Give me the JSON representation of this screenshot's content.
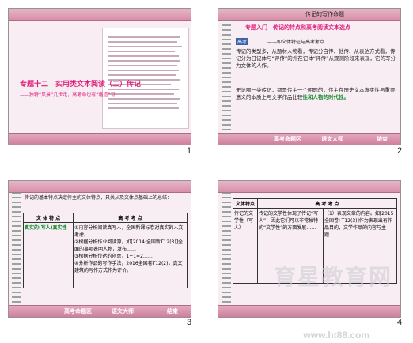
{
  "slides": [
    {
      "number": "1",
      "header": "",
      "title": "专题十二　实用类文本阅读（二）传记",
      "subtitle": "——独特“风景”几步走，高考命也有“路道”习",
      "nav": [
        "",
        "",
        ""
      ]
    },
    {
      "number": "2",
      "header": "传记的写作命题",
      "title": "专题入门　传记的特点和高考阅读文本选点",
      "badge": "高考",
      "sub": "——即文体特征与高考考点",
      "paragraphs": [
        "传记的类型多，从题材人物看，传记分自传、他传、从表达方式看，传记分为日记体与“评传”的外在记体“评传”从观测阶段来表现，它的写分为文体的人作。",
        "无论哪一类传记，都是传主一个明现的，传主在历史文本真实性与重要意义的本质上与文学作品比较"
      ],
      "highlight": "性和人物的时代性。",
      "nav": [
        "高考命题区",
        "语文大师",
        "结束"
      ]
    },
    {
      "number": "3",
      "intro": "传记的基本特点决定传主的文体特点，只关从及文体点基础上的总结：",
      "table_headers": [
        "文 体 特 点",
        "高 考 考 点"
      ],
      "left_label": "真实的(写人)真实性",
      "rows": [
        "①内容分析阅读真写人，全国新课标卷对真实的人文考虑。",
        "②根据分析作业阅读源，如[2014·全国新T12(3)]全面的事项表明人物，发布……",
        "③根据分析传达的创意，1+1=2……",
        "④分析作品的写作手法，2016全国卷T12(2)，真文建筑的写作方式作为评价。"
      ],
      "nav": [
        "高考命题区",
        "语文大师",
        "结束"
      ]
    },
    {
      "number": "4",
      "table_headers": [
        "文体特点",
        "高 考 考 点"
      ],
      "left_label": "传记的文学性（写人）",
      "mid": "传记的文学性体现了传记“写人”，因此它们可以非常独特的“文学性”的方面发展……",
      "right": "（1）表现文章的内容。如[2015全国卷I T12(3)]作为表现出有作品目的，文学作品的内容与主题……"
    }
  ],
  "watermark": "育星教育网",
  "watermark_url": "www.ht88.com"
}
